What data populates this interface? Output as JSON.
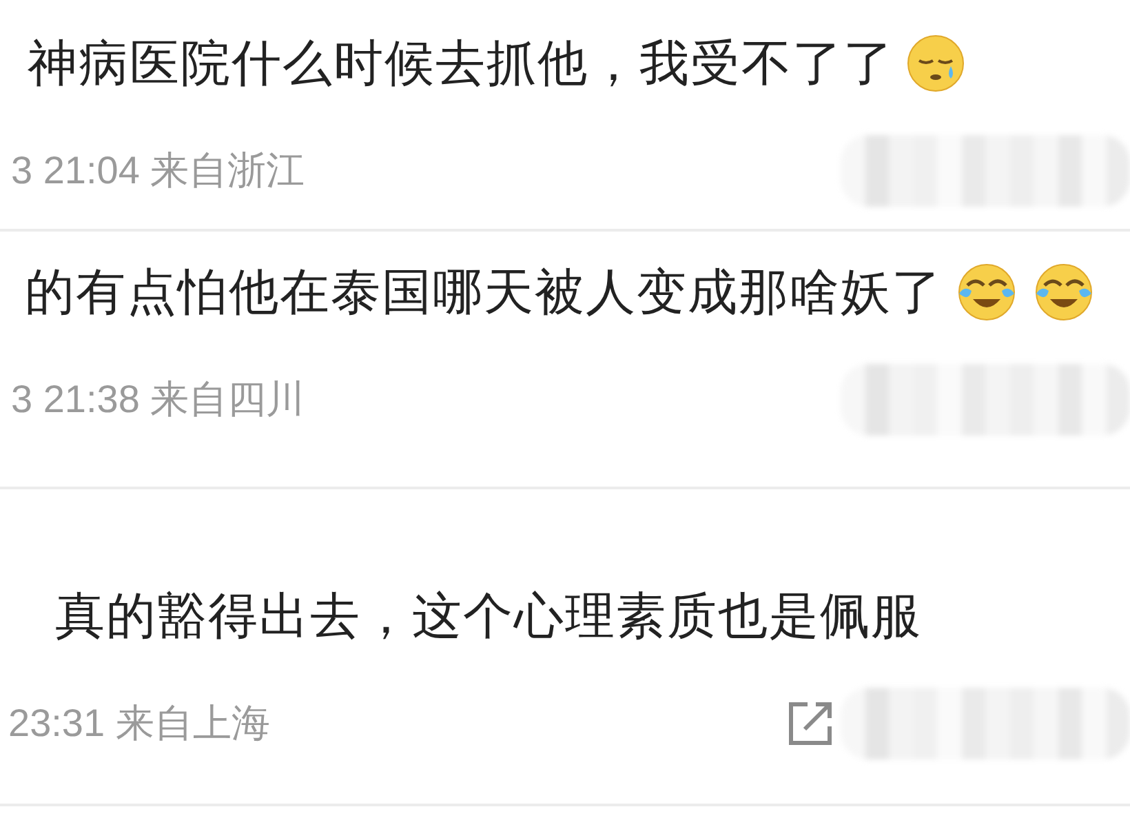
{
  "comments": [
    {
      "text": "神病医院什么时候去抓他，我受不了了",
      "emoji": [
        {
          "kind": "sleepy"
        }
      ],
      "meta": "3 21:04 来自浙江",
      "share_button": false
    },
    {
      "text": "的有点怕他在泰国哪天被人变成那啥妖了",
      "emoji": [
        {
          "kind": "laugh_cry"
        },
        {
          "kind": "laugh_cry"
        }
      ],
      "meta": "3 21:38 来自四川",
      "share_button": false
    },
    {
      "text": "真的豁得出去，这个心理素质也是佩服",
      "meta": "23:31 来自上海",
      "share_button": true
    }
  ]
}
